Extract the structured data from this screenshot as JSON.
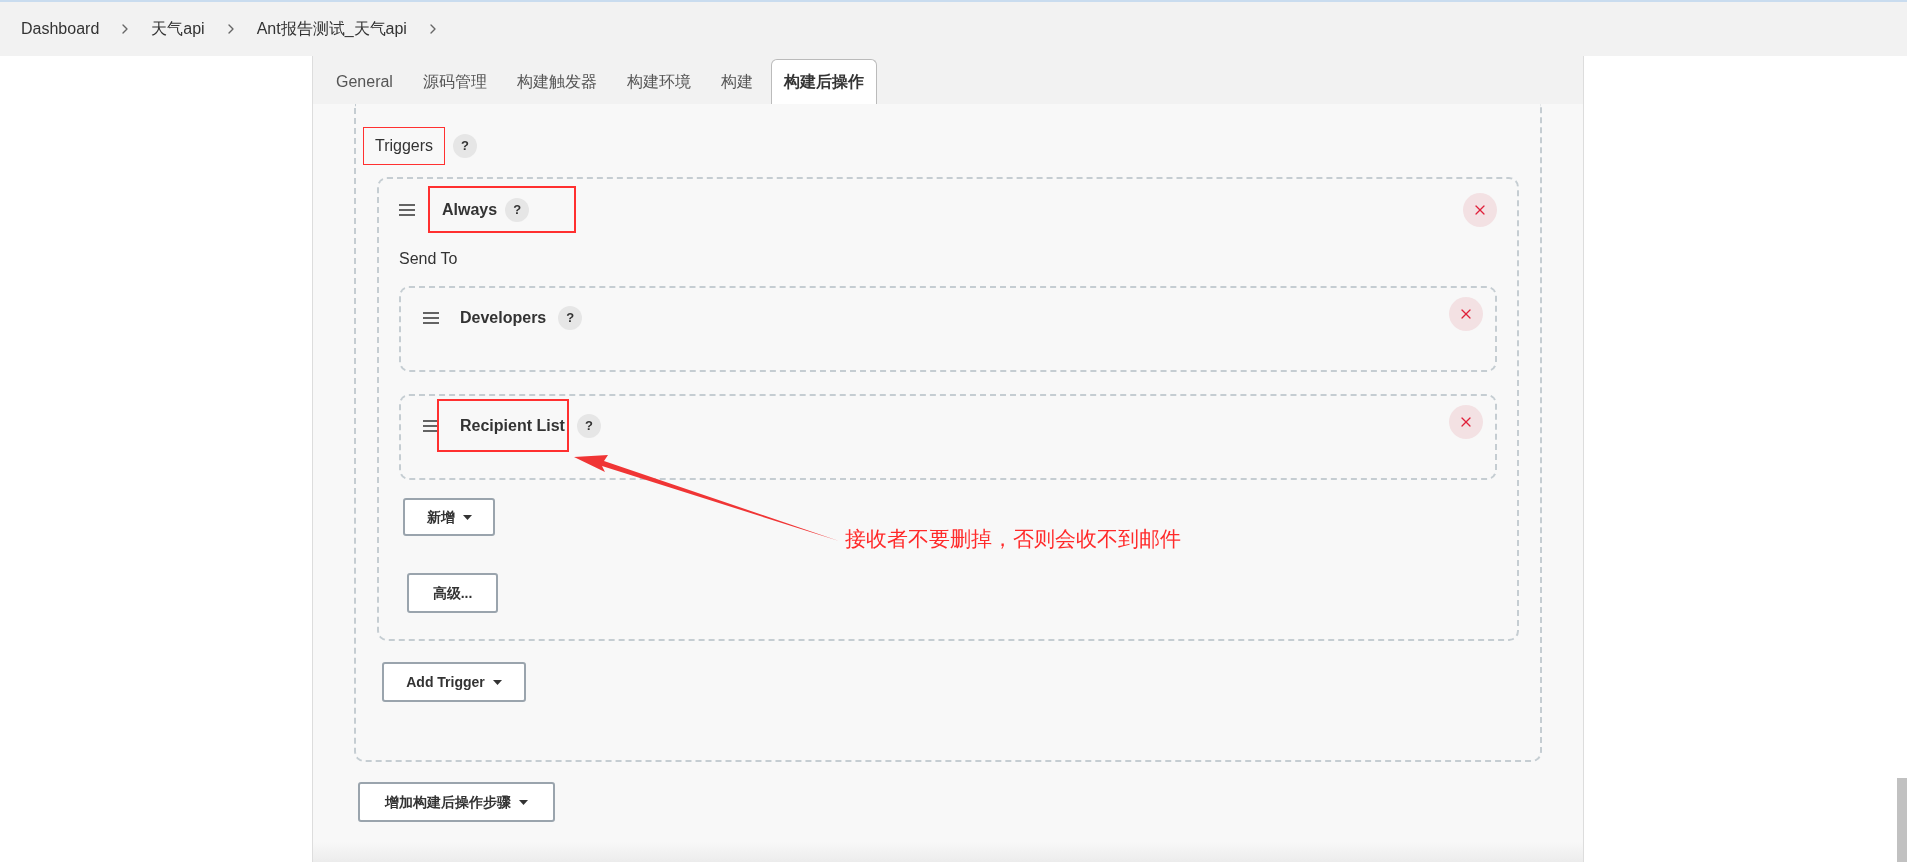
{
  "breadcrumb": [
    {
      "label": "Dashboard"
    },
    {
      "label": "天气api"
    },
    {
      "label": "Ant报告测试_天气api"
    }
  ],
  "tabs": [
    {
      "label": "General",
      "selected": false
    },
    {
      "label": "源码管理",
      "selected": false
    },
    {
      "label": "构建触发器",
      "selected": false
    },
    {
      "label": "构建环境",
      "selected": false
    },
    {
      "label": "构建",
      "selected": false
    },
    {
      "label": "构建后操作",
      "selected": true
    }
  ],
  "triggers": {
    "label": "Triggers",
    "help": "?",
    "highlighted": true,
    "items": [
      {
        "name": "Always",
        "help": "?",
        "highlighted": true,
        "send_to_label": "Send To",
        "recipients": [
          {
            "name": "Developers",
            "help": "?",
            "highlighted": false
          },
          {
            "name": "Recipient List",
            "help": "?",
            "highlighted": true
          }
        ],
        "add_button": "新增",
        "advanced_button": "高级..."
      }
    ]
  },
  "add_trigger_button": "Add Trigger",
  "add_post_build_button": "增加构建后操作步骤",
  "annotation": "接收者不要删掉，否则会收不到邮件"
}
